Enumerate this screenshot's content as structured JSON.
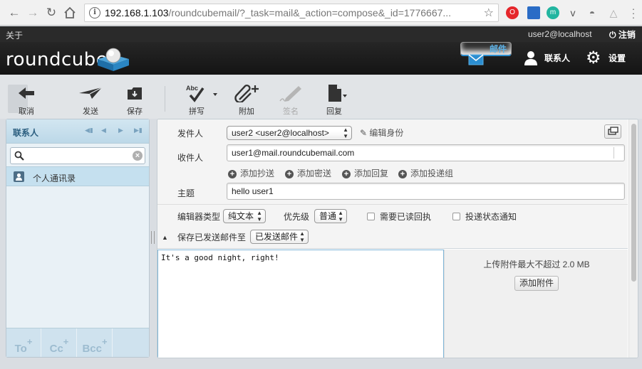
{
  "browser": {
    "url_host": "192.168.1.103",
    "url_path": "/roundcubemail/?_task=mail&_action=compose&_id=1776667...",
    "extensions": [
      {
        "name": "opera-icon",
        "color": "#e5262b",
        "glyph": "O"
      },
      {
        "name": "screen-icon",
        "color": "#2a6cc6",
        "glyph": ""
      },
      {
        "name": "m-icon",
        "color": "#22b5a0",
        "glyph": "m"
      },
      {
        "name": "pocket-icon",
        "color": "#555555",
        "glyph": "v"
      },
      {
        "name": "spy-icon",
        "color": "#777777",
        "glyph": "◓"
      },
      {
        "name": "triangle-icon",
        "color": "#aaaaaa",
        "glyph": "△"
      }
    ]
  },
  "topline": {
    "about": "关于",
    "user": "user2@localhost",
    "logout": "注销"
  },
  "header": {
    "logo": "roundcube",
    "tasks": [
      {
        "label": "邮件",
        "selected": true
      },
      {
        "label": "联系人",
        "selected": false
      },
      {
        "label": "设置",
        "selected": false
      }
    ]
  },
  "toolbar": {
    "cancel": "取消",
    "send": "发送",
    "save": "保存",
    "spell": "拼写",
    "attach": "附加",
    "signature": "签名",
    "responses": "回复"
  },
  "contacts": {
    "title": "联系人",
    "search_placeholder": "",
    "addressbook": "个人通讯录",
    "to": "To",
    "cc": "Cc",
    "bcc": "Bcc"
  },
  "compose": {
    "from_label": "发件人",
    "from_value": "user2 <user2@localhost>",
    "edit_identity": "编辑身份",
    "to_label": "收件人",
    "to_value": "user1@mail.roundcubemail.com",
    "add_cc": "添加抄送",
    "add_bcc": "添加密送",
    "add_reply": "添加回复",
    "add_followup": "添加投递组",
    "subject_label": "主题",
    "subject_value": "hello user1",
    "editor_type_label": "编辑器类型",
    "editor_type_value": "纯文本",
    "priority_label": "优先级",
    "priority_value": "普通",
    "receipt_label": "需要已读回执",
    "dsn_label": "投递状态通知",
    "store_label": "保存已发送邮件至",
    "store_value": "已发送邮件",
    "body": "It's a good night, right!",
    "upload_note": "上传附件最大不超过 2.0 MB",
    "add_attachment": "添加附件"
  }
}
